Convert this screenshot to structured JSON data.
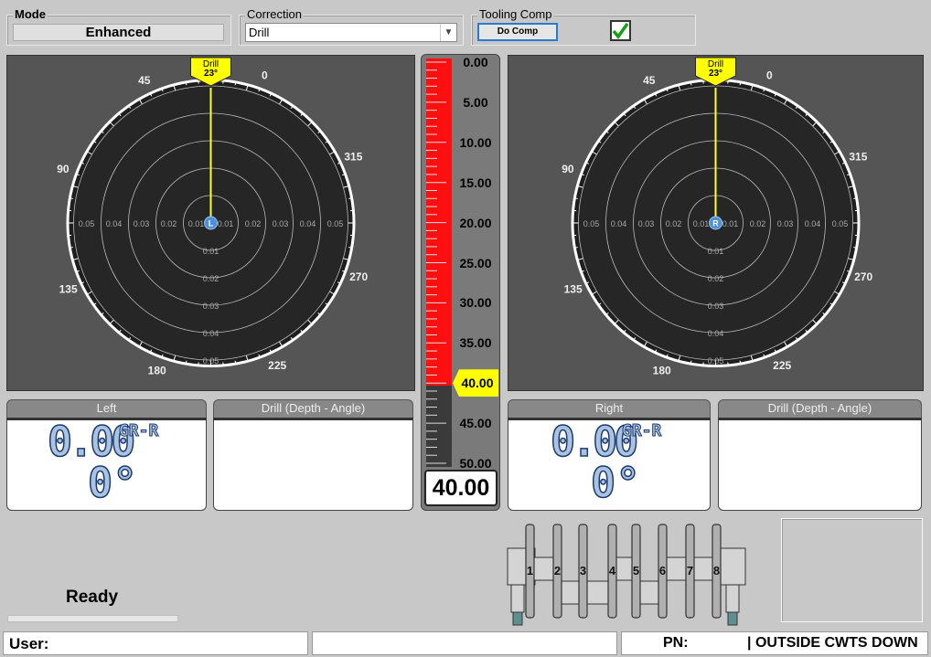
{
  "mode": {
    "title": "Mode",
    "value": "Enhanced"
  },
  "correction": {
    "title": "Correction",
    "selected": "Drill"
  },
  "tooling_comp": {
    "title": "Tooling Comp",
    "button_label": "Do Comp",
    "checked": true
  },
  "polar_left": {
    "marker": {
      "label": "Drill",
      "angle": "23°"
    },
    "center_label": "L",
    "angle_labels": [
      "0",
      "45",
      "90",
      "135",
      "180",
      "225",
      "270",
      "315"
    ],
    "ring_labels": [
      "0.01",
      "0.02",
      "0.03",
      "0.04",
      "0.05"
    ]
  },
  "polar_right": {
    "marker": {
      "label": "Drill",
      "angle": "23°"
    },
    "center_label": "R",
    "angle_labels": [
      "0",
      "45",
      "90",
      "135",
      "180",
      "225",
      "270",
      "315"
    ],
    "ring_labels": [
      "0.01",
      "0.02",
      "0.03",
      "0.04",
      "0.05"
    ]
  },
  "depth_gauge": {
    "ticks": [
      "0.00",
      "5.00",
      "10.00",
      "15.00",
      "20.00",
      "25.00",
      "30.00",
      "35.00",
      "40.00",
      "45.00",
      "50.00"
    ],
    "current_value": "40.00",
    "fill_fraction": 0.8,
    "fill_color": "#ff1010",
    "highlight_color": "#ffff00"
  },
  "left_readout": {
    "tab": "Left",
    "value": "0.00",
    "unit": "GR-R",
    "angle": "0°"
  },
  "left_drill": {
    "tab": "Drill (Depth - Angle)"
  },
  "right_readout": {
    "tab": "Right",
    "value": "0.00",
    "unit": "GR-R",
    "angle": "0°"
  },
  "right_drill": {
    "tab": "Drill (Depth - Angle)"
  },
  "status": {
    "text": "Ready",
    "progress": 0
  },
  "crankshaft": {
    "journals": [
      "1",
      "2",
      "3",
      "4",
      "5",
      "6",
      "7",
      "8"
    ]
  },
  "statusbar": {
    "user_label": "User:",
    "pn_label": "PN:",
    "message": "| OUTSIDE CWTS DOWN"
  }
}
